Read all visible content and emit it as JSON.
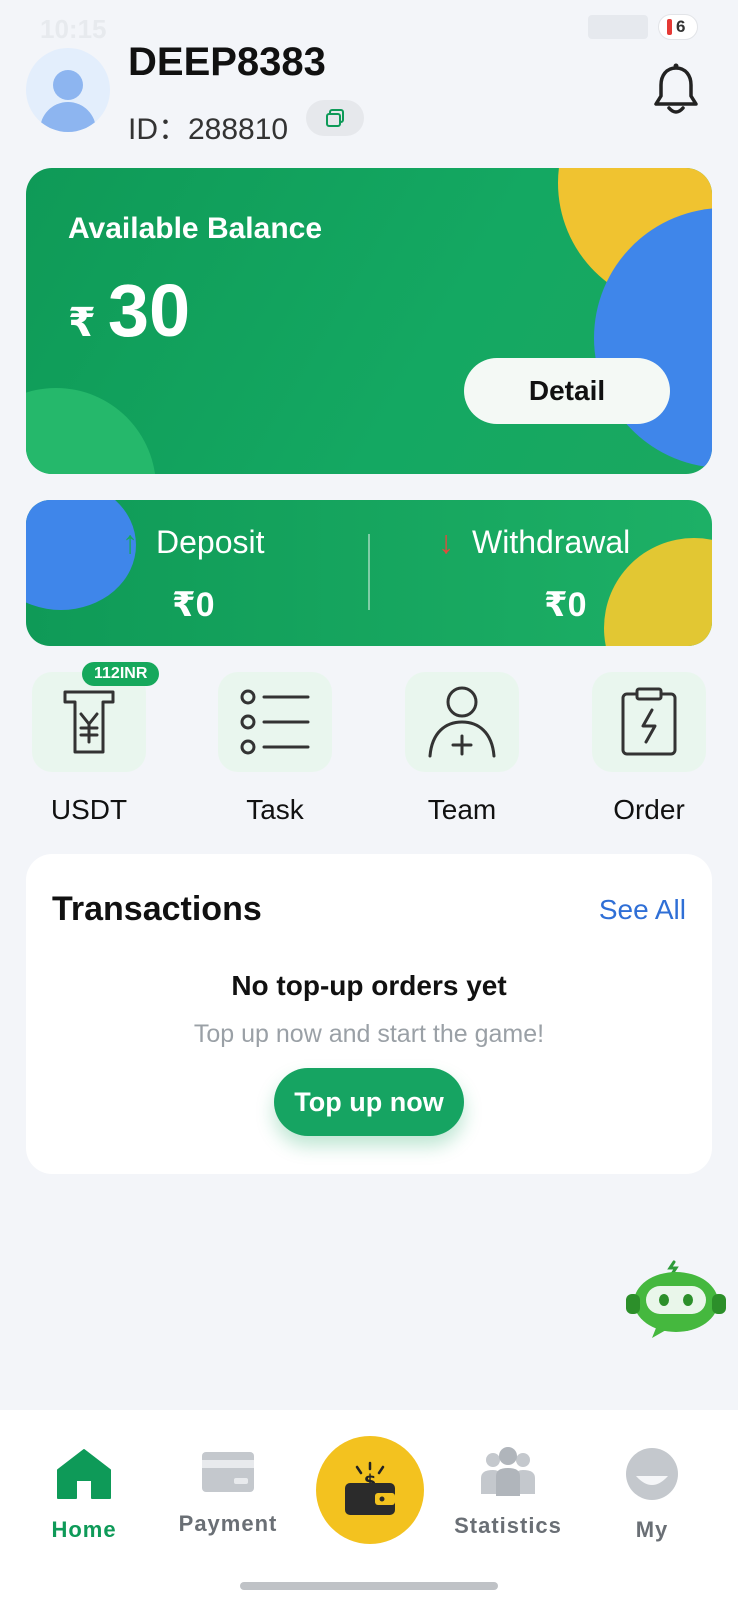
{
  "status_bar": {
    "time": "10:15",
    "battery": "6"
  },
  "header": {
    "username": "DEEP8383",
    "id_label": "ID：",
    "id_value": "288810"
  },
  "balance": {
    "label": "Available Balance",
    "currency": "₹",
    "amount": "30",
    "detail_label": "Detail"
  },
  "flows": {
    "deposit": {
      "label": "Deposit",
      "currency": "₹",
      "amount": "0"
    },
    "withdrawal": {
      "label": "Withdrawal",
      "currency": "₹",
      "amount": "0"
    }
  },
  "quick_actions": [
    {
      "label": "USDT",
      "badge": "112INR",
      "icon": "usdt-receipt-icon"
    },
    {
      "label": "Task",
      "icon": "task-list-icon"
    },
    {
      "label": "Team",
      "icon": "team-add-icon"
    },
    {
      "label": "Order",
      "icon": "order-clipboard-icon"
    }
  ],
  "transactions": {
    "title": "Transactions",
    "see_all": "See All",
    "empty_title": "No top-up orders yet",
    "empty_subtitle": "Top up now and start the game!",
    "cta": "Top up now"
  },
  "bottom_nav": {
    "items": [
      {
        "label": "Home",
        "icon": "home-icon",
        "active": true
      },
      {
        "label": "Payment",
        "icon": "card-icon",
        "active": false
      },
      {
        "label": "Statistics",
        "icon": "people-icon",
        "active": false
      },
      {
        "label": "My",
        "icon": "profile-icon",
        "active": false
      }
    ],
    "center_icon": "wallet-icon"
  },
  "colors": {
    "primary_green": "#16a462",
    "accent_yellow": "#f3c21f",
    "accent_blue": "#3f86ea",
    "link_blue": "#2f6fd6"
  }
}
